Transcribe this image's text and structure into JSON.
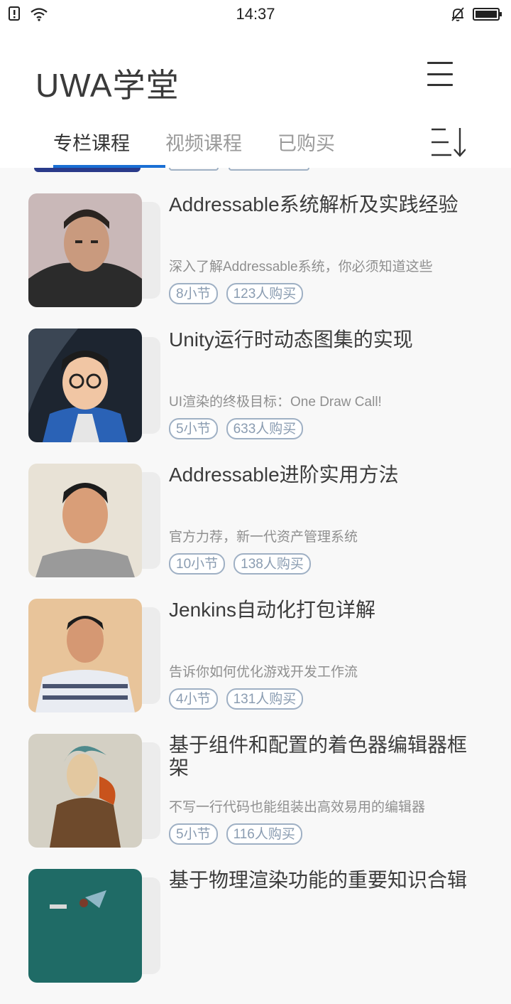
{
  "status_bar": {
    "time": "14:37"
  },
  "header": {
    "title": "UWA学堂"
  },
  "tabs": [
    {
      "label": "专栏课程",
      "active": true
    },
    {
      "label": "视频课程",
      "active": false
    },
    {
      "label": "已购买",
      "active": false
    }
  ],
  "courses": [
    {
      "title": "Addressable系统解析及实践经验",
      "subtitle": "深入了解Addressable系统，你必须知道这些",
      "lessons": "8小节",
      "buyers": "123人购买"
    },
    {
      "title": "Unity运行时动态图集的实现",
      "subtitle": "UI渲染的终极目标：One Draw Call!",
      "lessons": "5小节",
      "buyers": "633人购买"
    },
    {
      "title": "Addressable进阶实用方法",
      "subtitle": "官方力荐，新一代资产管理系统",
      "lessons": "10小节",
      "buyers": "138人购买"
    },
    {
      "title": "Jenkins自动化打包详解",
      "subtitle": "告诉你如何优化游戏开发工作流",
      "lessons": "4小节",
      "buyers": "131人购买"
    },
    {
      "title": "基于组件和配置的着色器编辑器框架",
      "subtitle": "不写一行代码也能组装出高效易用的编辑器",
      "lessons": "5小节",
      "buyers": "116人购买"
    },
    {
      "title": "基于物理渲染功能的重要知识合辑",
      "subtitle": "",
      "lessons": "",
      "buyers": ""
    }
  ],
  "colors": {
    "accent": "#1a6fd4",
    "tag_border": "#9fb0c4"
  }
}
